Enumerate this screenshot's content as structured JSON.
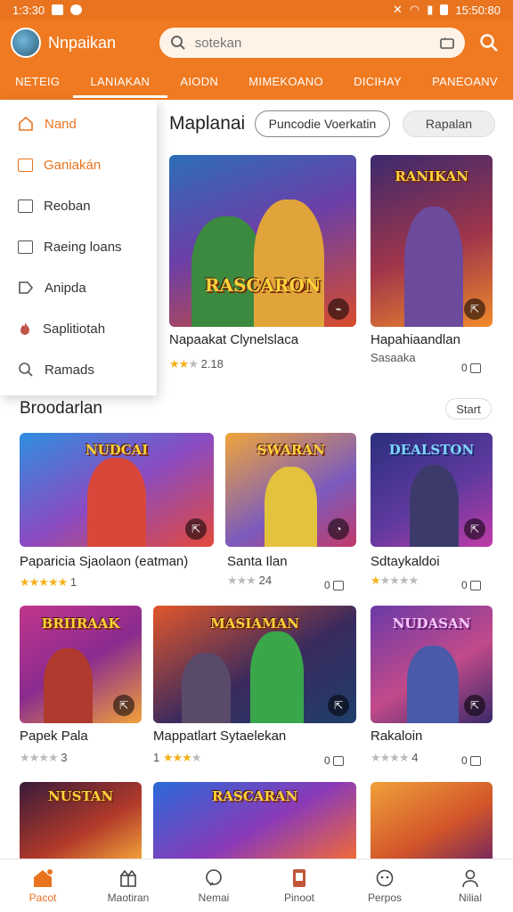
{
  "status_bar": {
    "time": "1:3:30",
    "clock_right": "15:50:80"
  },
  "app": {
    "title": "Nnpaikan"
  },
  "search": {
    "placeholder": "sotekan"
  },
  "tabs": [
    {
      "label": "NETEIG"
    },
    {
      "label": "LANIAKAN"
    },
    {
      "label": "AIODN"
    },
    {
      "label": "MIMEKOANO"
    },
    {
      "label": "DICIHAY"
    },
    {
      "label": "PANEOANV"
    }
  ],
  "dropdown": {
    "items": [
      {
        "label": "Nand",
        "icon": "home-outline-icon"
      },
      {
        "label": "Ganiakán",
        "icon": "bag-icon"
      },
      {
        "label": "Reoban",
        "icon": "checkbox-icon"
      },
      {
        "label": "Raeing loans",
        "icon": "checkbox-icon"
      },
      {
        "label": "Anipda",
        "icon": "tag-icon"
      },
      {
        "label": "Saplitiotah",
        "icon": "flame-icon"
      },
      {
        "label": "Ramads",
        "icon": "search-icon"
      }
    ]
  },
  "featured": {
    "title": "Maplanai",
    "pill_primary": "Puncodie Voerkatin",
    "pill_secondary": "Rapalan",
    "cards": [
      {
        "title": "Napaakat Clynelslaca",
        "rating": "2.18",
        "stars": 3,
        "logo": "RASCARON",
        "badge": "⌁"
      },
      {
        "title": "Hapahiaandlan",
        "subtitle": "Sasaaka",
        "downloads": "0",
        "logo": "RANIKAN",
        "badge": "⇱"
      }
    ]
  },
  "browse": {
    "title": "Broodarlan",
    "start_label": "Start",
    "cards": [
      {
        "title": "Paparicia Sjaolaon (eatman)",
        "stars": 5,
        "rating": "1",
        "logo": "NUDCAI",
        "badge": "⇱"
      },
      {
        "title": "Santa Ilan",
        "stars": 0,
        "rating": "24",
        "downloads": "0",
        "logo": "SWARAN",
        "badge": "◔"
      },
      {
        "title": "Sdtaykaldoi",
        "stars": 1,
        "rating": "",
        "downloads": "0",
        "logo": "DEALSTON",
        "badge": "⇱"
      },
      {
        "title": "Papek Pala",
        "stars": 1,
        "rating": "3",
        "logo": "BRIIRAAK",
        "badge": "⇱"
      },
      {
        "title": "Mappatlart Sytaelekan",
        "stars": 3,
        "rating": "1",
        "downloads": "0",
        "logo": "MASIAMAN",
        "badge": "⇱"
      },
      {
        "title": "Rakaloin",
        "stars": 0,
        "rating": "4",
        "downloads": "0",
        "logo": "NUDASAN",
        "badge": "⇱"
      },
      {
        "title": "",
        "logo": "NUSTAN"
      },
      {
        "title": "",
        "logo": "RASCARAN"
      },
      {
        "title": "",
        "logo": ""
      },
      {
        "title": "",
        "logo": ""
      }
    ]
  },
  "bottom_nav": [
    {
      "label": "Pacot",
      "icon": "home-icon"
    },
    {
      "label": "Maotiran",
      "icon": "gift-icon"
    },
    {
      "label": "Nemai",
      "icon": "chat-icon"
    },
    {
      "label": "Pinoot",
      "icon": "phone-icon"
    },
    {
      "label": "Perpos",
      "icon": "game-icon"
    },
    {
      "label": "Nilial",
      "icon": "user-icon"
    }
  ],
  "colors": {
    "accent": "#ef7a21",
    "star": "#f2b21b"
  }
}
